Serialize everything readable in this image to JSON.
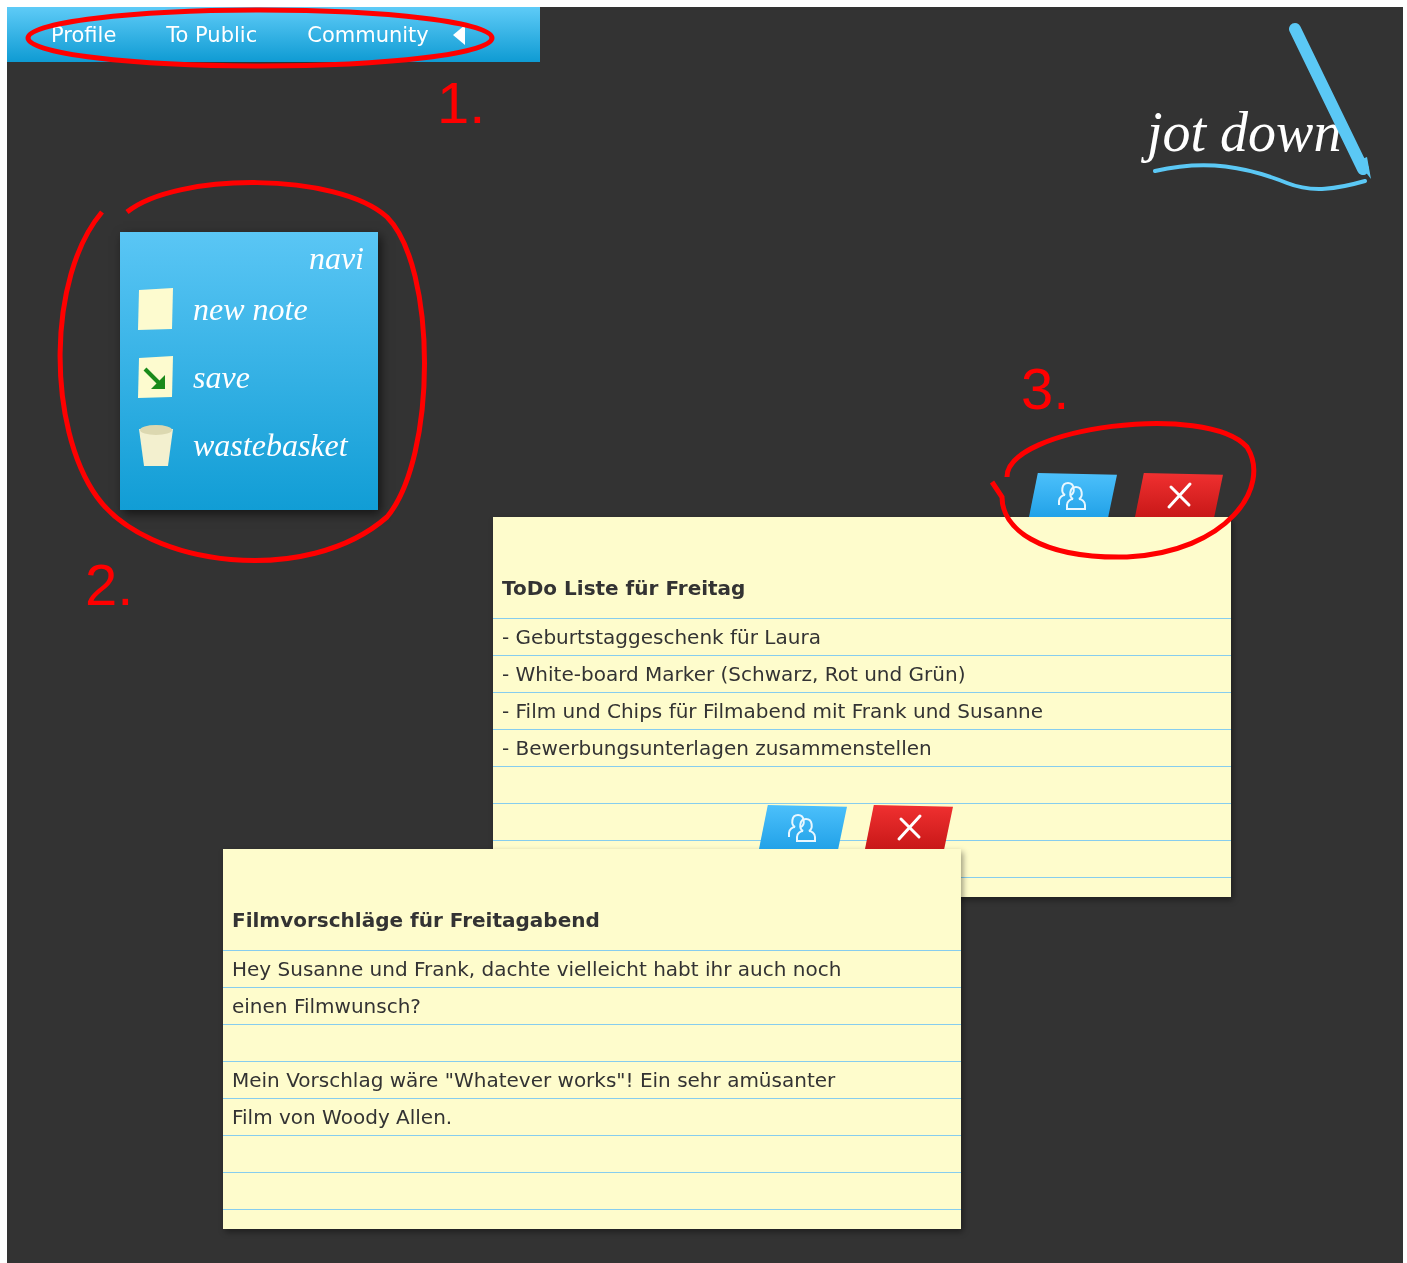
{
  "top_bar": {
    "items": [
      {
        "label": "Profile"
      },
      {
        "label": "To Public"
      },
      {
        "label": "Community"
      }
    ]
  },
  "logo": {
    "text": "jot down"
  },
  "navi": {
    "title": "navi",
    "items": [
      {
        "kind": "note",
        "label": "new note"
      },
      {
        "kind": "save",
        "label": "save"
      },
      {
        "kind": "trash",
        "label": "wastebasket"
      }
    ]
  },
  "notes": [
    {
      "kind": "list",
      "title": "ToDo Liste für Freitag",
      "items": [
        "- Geburtstaggeschenk für Laura",
        "- White-board Marker (Schwarz, Rot und Grün)",
        "- Film und Chips für Filmabend mit Frank und Susanne",
        "- Bewerbungsunterlagen zusammenstellen"
      ]
    },
    {
      "kind": "text",
      "title": "Filmvorschläge für Freitagabend",
      "paragraphs": [
        "Hey Susanne und Frank, dachte vielleicht habt ihr auch noch\neinen Filmwunsch?",
        "Mein Vorschlag wäre \"Whatever works\"! Ein sehr amüsanter\nFilm von Woody Allen."
      ]
    }
  ],
  "annotations": [
    {
      "label": "1."
    },
    {
      "label": "2."
    },
    {
      "label": "3."
    }
  ]
}
